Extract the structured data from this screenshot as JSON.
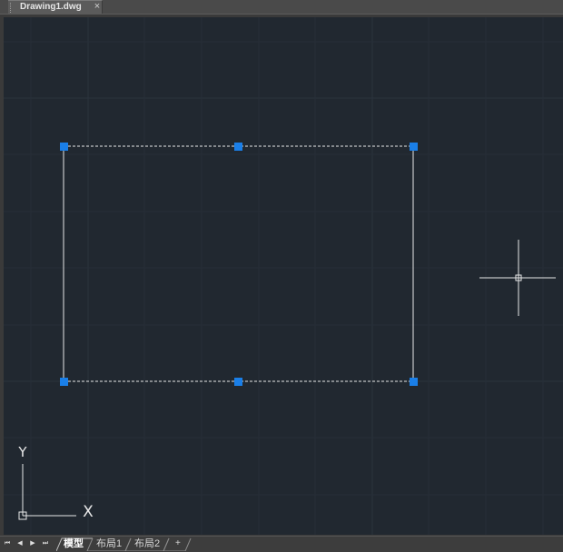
{
  "document": {
    "tab_label": "Drawing1.dwg",
    "close_glyph": "×"
  },
  "ucs": {
    "y_label": "Y",
    "x_glyph": "X"
  },
  "layout_tabs": {
    "nav": [
      "⏮",
      "◀",
      "▶",
      "⏭"
    ],
    "tabs": [
      {
        "label": "模型",
        "active": true
      },
      {
        "label": "布局1",
        "active": false
      },
      {
        "label": "布局2",
        "active": false
      }
    ],
    "add_label": "+"
  },
  "colors": {
    "canvas_bg": "#212830",
    "grip_blue": "#1a7fe8",
    "line": "#e8e8e8"
  }
}
